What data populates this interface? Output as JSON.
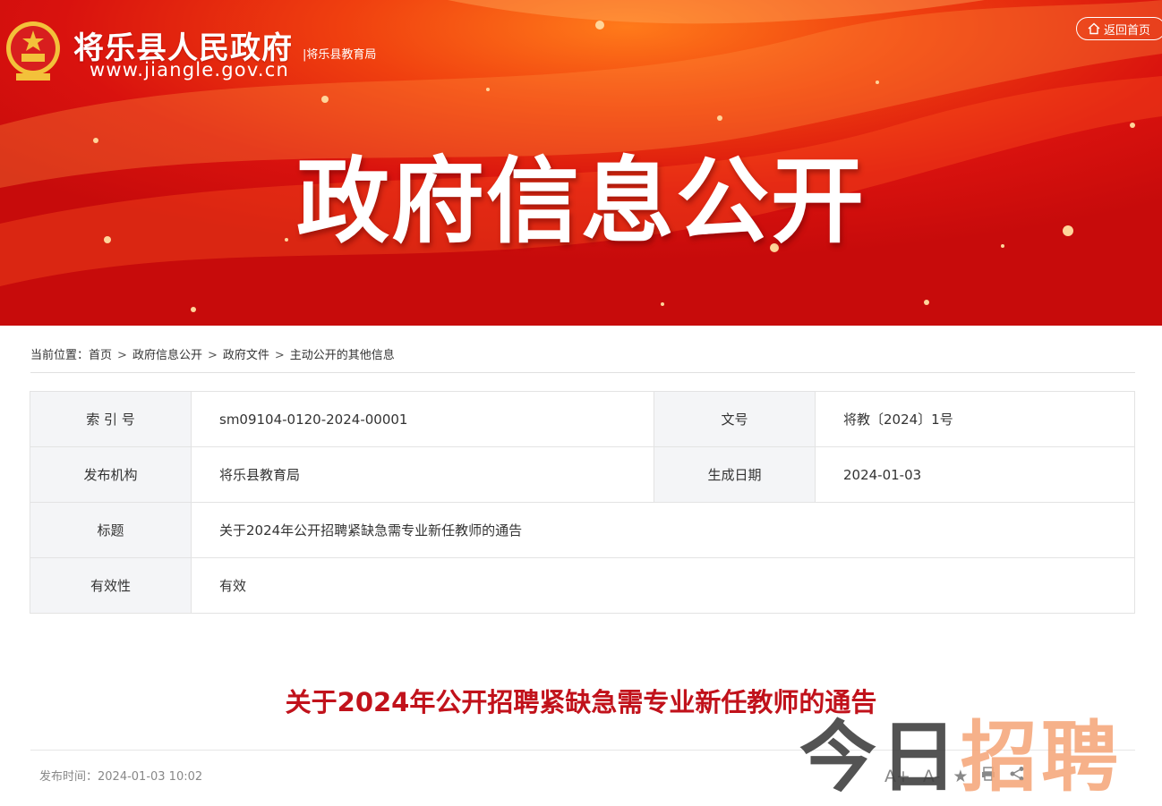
{
  "header": {
    "site_name": "将乐县人民政府",
    "site_url": "www.jiangle.gov.cn",
    "sub_org": "|将乐县教育局",
    "home_button": "返回首页",
    "banner_title": "政府信息公开"
  },
  "breadcrumb": {
    "prefix": "当前位置：",
    "items": [
      "首页",
      "政府信息公开",
      "政府文件",
      "主动公开的其他信息"
    ],
    "separator": ">"
  },
  "info_table": {
    "index_label": "索 引 号",
    "index_value": "sm09104-0120-2024-00001",
    "doc_no_label": "文号",
    "doc_no_value": "将教〔2024〕1号",
    "issuer_label": "发布机构",
    "issuer_value": "将乐县教育局",
    "date_label": "生成日期",
    "date_value": "2024-01-03",
    "title_label": "标题",
    "title_value": "关于2024年公开招聘紧缺急需专业新任教师的通告",
    "validity_label": "有效性",
    "validity_value": "有效"
  },
  "article": {
    "title": "关于2024年公开招聘紧缺急需专业新任教师的通告",
    "publish_time": "发布时间：2024-01-03 10:02",
    "tools": {
      "font_larger": "A+",
      "font_smaller": "A-",
      "favorite_icon": "star-icon",
      "print_icon": "print-icon",
      "share_icon": "share-icon"
    }
  },
  "watermark": {
    "part1": "今日",
    "part2": "招聘"
  },
  "colors": {
    "banner_red": "#d9120e",
    "title_red": "#c1121b",
    "label_bg": "#f4f5f7"
  }
}
